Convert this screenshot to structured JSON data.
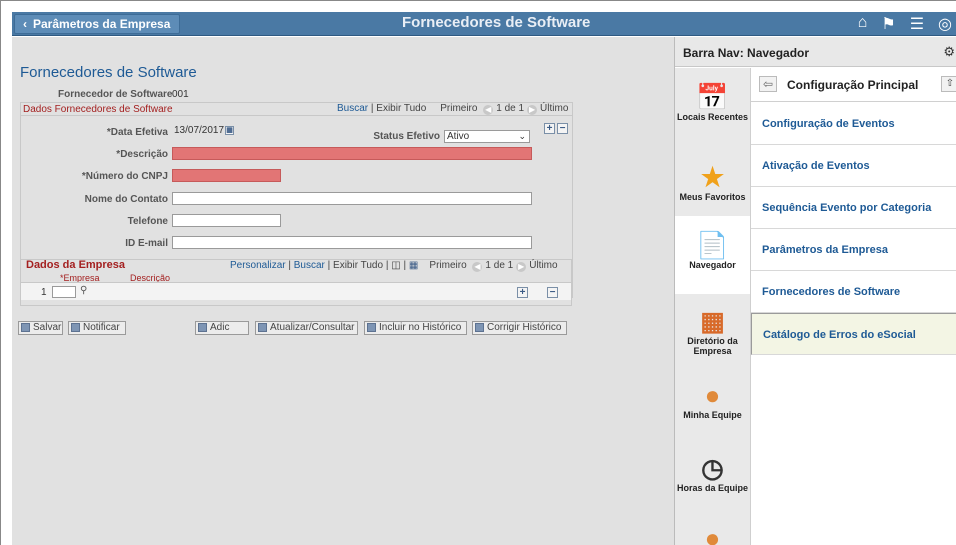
{
  "topbar": {
    "back_label": "Parâmetros da Empresa",
    "title": "Fornecedores de Software"
  },
  "page": {
    "title": "Fornecedores de Software",
    "fornecedor_label": "Fornecedor de Software",
    "fornecedor_value": "001",
    "section_title": "Dados Fornecedores de Software",
    "section_nav": {
      "buscar": "Buscar",
      "exibir_tudo": "Exibir Tudo",
      "primeiro": "Primeiro",
      "count": "1 de 1",
      "ultimo": "Último"
    },
    "fields": {
      "data_efetiva_label": "*Data Efetiva",
      "data_efetiva_value": "13/07/2017",
      "status_label": "Status Efetivo",
      "status_value": "Ativo",
      "descricao_label": "*Descrição",
      "cnpj_label": "*Número do CNPJ",
      "contato_label": "Nome do Contato",
      "telefone_label": "Telefone",
      "email_label": "ID E-mail"
    },
    "grid": {
      "title": "Dados da Empresa",
      "personalizar": "Personalizar",
      "buscar": "Buscar",
      "exibir_tudo": "Exibir Tudo",
      "primeiro": "Primeiro",
      "count": "1 de 1",
      "ultimo": "Último",
      "col_empresa": "*Empresa",
      "col_descricao": "Descrição",
      "row_num": "1"
    },
    "buttons": {
      "salvar": "Salvar",
      "notificar": "Notificar",
      "adic": "Adic",
      "atualizar": "Atualizar/Consultar",
      "incluir": "Incluir no Histórico",
      "corrigir": "Corrigir Histórico"
    }
  },
  "sidebar": {
    "header": "Barra Nav: Navegador",
    "icons": [
      {
        "label": "Locais Recentes",
        "icon": "calendar-icon"
      },
      {
        "label": "Meus Favoritos",
        "icon": "star-icon"
      },
      {
        "label": "Navegador",
        "icon": "document-icon"
      },
      {
        "label": "Diretório da Empresa",
        "icon": "org-chart-icon"
      },
      {
        "label": "Minha Equipe",
        "icon": "team-icon"
      },
      {
        "label": "Horas da Equipe",
        "icon": "clock-icon"
      }
    ],
    "list_title": "Configuração Principal",
    "items": [
      "Configuração de Eventos",
      "Ativação de Eventos",
      "Sequência Evento por Categoria",
      "Parâmetros da Empresa",
      "Fornecedores de Software",
      "Catálogo de Erros do eSocial"
    ]
  }
}
